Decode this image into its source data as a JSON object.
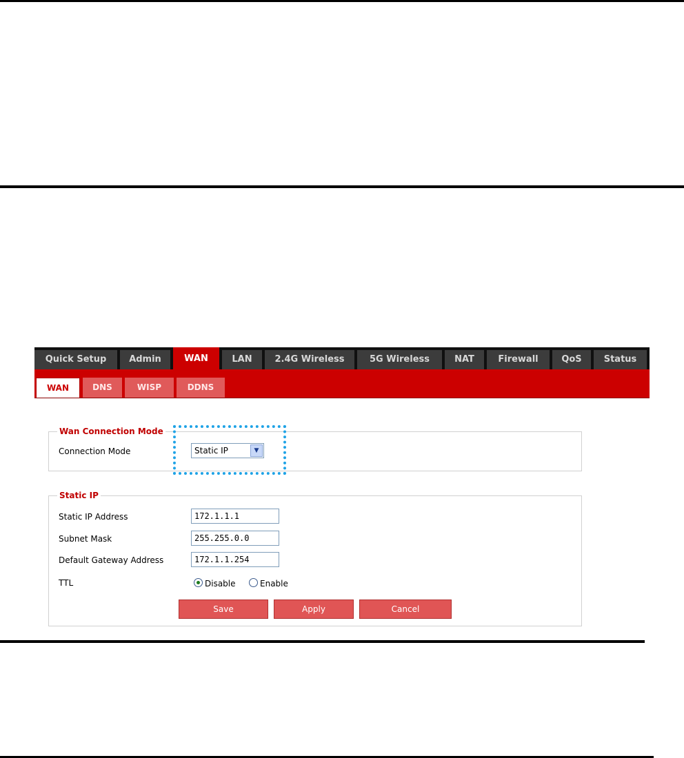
{
  "nav": {
    "tabs": [
      {
        "label": "Quick Setup"
      },
      {
        "label": "Admin"
      },
      {
        "label": "WAN"
      },
      {
        "label": "LAN"
      },
      {
        "label": "2.4G Wireless"
      },
      {
        "label": "5G Wireless"
      },
      {
        "label": "NAT"
      },
      {
        "label": "Firewall"
      },
      {
        "label": "QoS"
      },
      {
        "label": "Status"
      }
    ],
    "active_tab": "WAN",
    "subtabs": [
      {
        "label": "WAN"
      },
      {
        "label": "DNS"
      },
      {
        "label": "WISP"
      },
      {
        "label": "DDNS"
      }
    ],
    "active_subtab": "WAN"
  },
  "wan_mode": {
    "legend": "Wan Connection Mode",
    "connection_mode_label": "Connection Mode",
    "connection_mode_value": "Static IP"
  },
  "static_ip": {
    "legend": "Static IP",
    "ip_label": "Static IP Address",
    "ip_value": "172.1.1.1",
    "mask_label": "Subnet Mask",
    "mask_value": "255.255.0.0",
    "gateway_label": "Default Gateway Address",
    "gateway_value": "172.1.1.254",
    "ttl_label": "TTL",
    "ttl_disable": "Disable",
    "ttl_enable": "Enable",
    "ttl_selected": "Disable"
  },
  "buttons": {
    "save": "Save",
    "apply": "Apply",
    "cancel": "Cancel"
  },
  "colors": {
    "accent": "#cc0000",
    "highlight": "#1fa3e6"
  }
}
